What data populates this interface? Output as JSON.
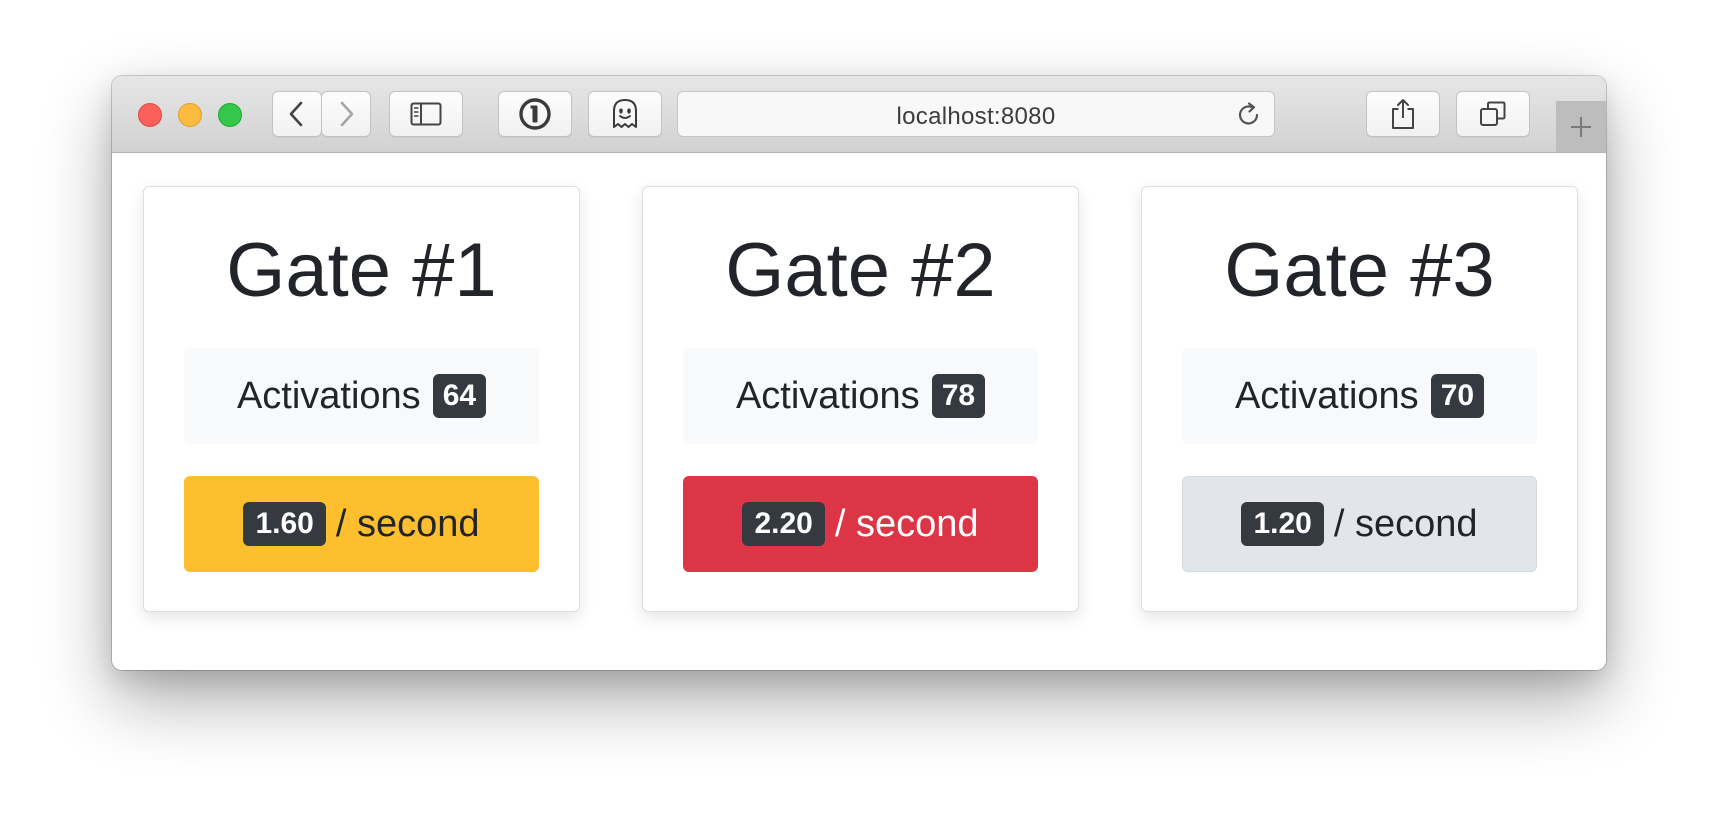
{
  "browser": {
    "url": "localhost:8080",
    "icons": {
      "back": "chevron-left-icon",
      "forward": "chevron-right-icon",
      "sidebar": "sidebar-icon",
      "password_manager": "1password-icon",
      "ghostery": "ghost-icon",
      "reload": "reload-icon",
      "share": "share-icon",
      "tabs": "tabs-overview-icon",
      "new_tab": "plus-icon"
    }
  },
  "colors": {
    "warning": "#fdbf2d",
    "danger": "#dc3545",
    "light": "#e2e6ea",
    "badge": "#343a40"
  },
  "gates": [
    {
      "title": "Gate #1",
      "activations_label": "Activations",
      "activations": "64",
      "rate": "1.60",
      "rate_unit": "/ second",
      "status": "warning"
    },
    {
      "title": "Gate #2",
      "activations_label": "Activations",
      "activations": "78",
      "rate": "2.20",
      "rate_unit": "/ second",
      "status": "danger"
    },
    {
      "title": "Gate #3",
      "activations_label": "Activations",
      "activations": "70",
      "rate": "1.20",
      "rate_unit": "/ second",
      "status": "light"
    }
  ]
}
